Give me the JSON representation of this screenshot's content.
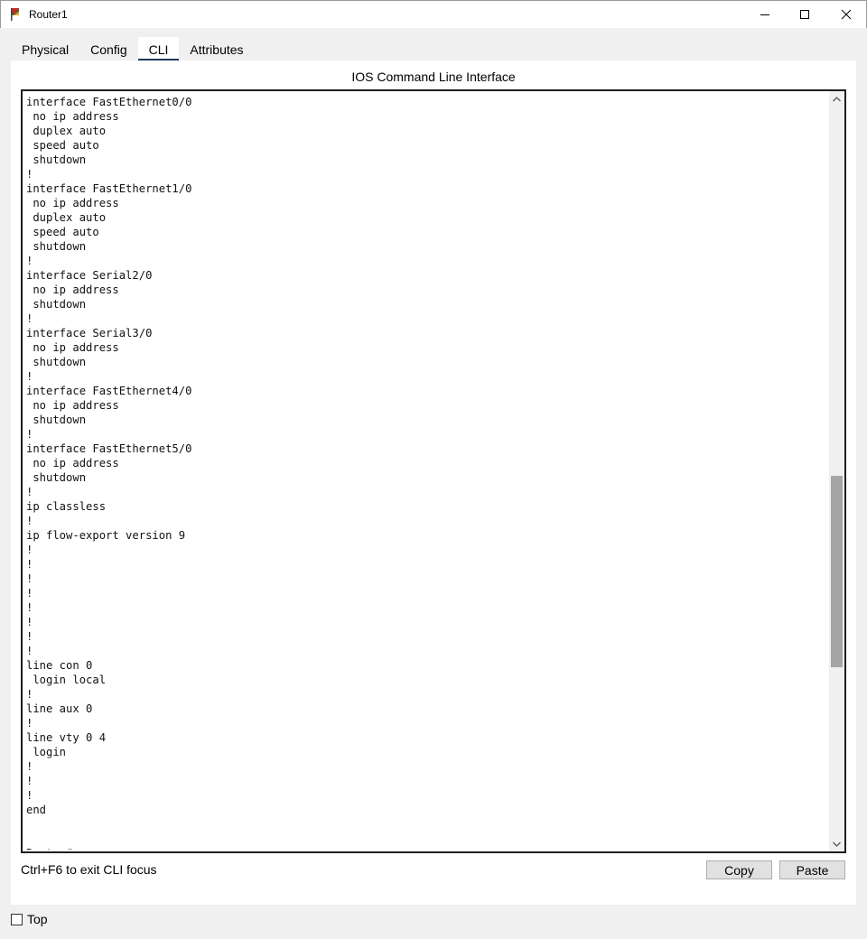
{
  "window": {
    "title": "Router1"
  },
  "tabs": [
    {
      "label": "Physical"
    },
    {
      "label": "Config"
    },
    {
      "label": "CLI"
    },
    {
      "label": "Attributes"
    }
  ],
  "active_tab": "CLI",
  "panel": {
    "title": "IOS Command Line Interface"
  },
  "terminal": {
    "lines": [
      "interface FastEthernet0/0",
      " no ip address",
      " duplex auto",
      " speed auto",
      " shutdown",
      "!",
      "interface FastEthernet1/0",
      " no ip address",
      " duplex auto",
      " speed auto",
      " shutdown",
      "!",
      "interface Serial2/0",
      " no ip address",
      " shutdown",
      "!",
      "interface Serial3/0",
      " no ip address",
      " shutdown",
      "!",
      "interface FastEthernet4/0",
      " no ip address",
      " shutdown",
      "!",
      "interface FastEthernet5/0",
      " no ip address",
      " shutdown",
      "!",
      "ip classless",
      "!",
      "ip flow-export version 9",
      "!",
      "!",
      "!",
      "!",
      "!",
      "!",
      "!",
      "!",
      "line con 0",
      " login local",
      "!",
      "line aux 0",
      "!",
      "line vty 0 4",
      " login",
      "!",
      "!",
      "!",
      "end",
      "",
      "",
      "Router#copy"
    ]
  },
  "footer": {
    "hint": "Ctrl+F6 to exit CLI focus",
    "copy_label": "Copy",
    "paste_label": "Paste"
  },
  "top_checkbox": {
    "label": "Top",
    "checked": false
  },
  "icons": {
    "app": "router-app-icon",
    "minimize": "minimize-icon",
    "maximize": "maximize-icon",
    "close": "close-icon",
    "scroll_up": "chevron-up-icon",
    "scroll_down": "chevron-down-icon"
  },
  "colors": {
    "active_tab_underline": "#1a3a5c",
    "scroll_thumb": "#a6a6a6"
  }
}
